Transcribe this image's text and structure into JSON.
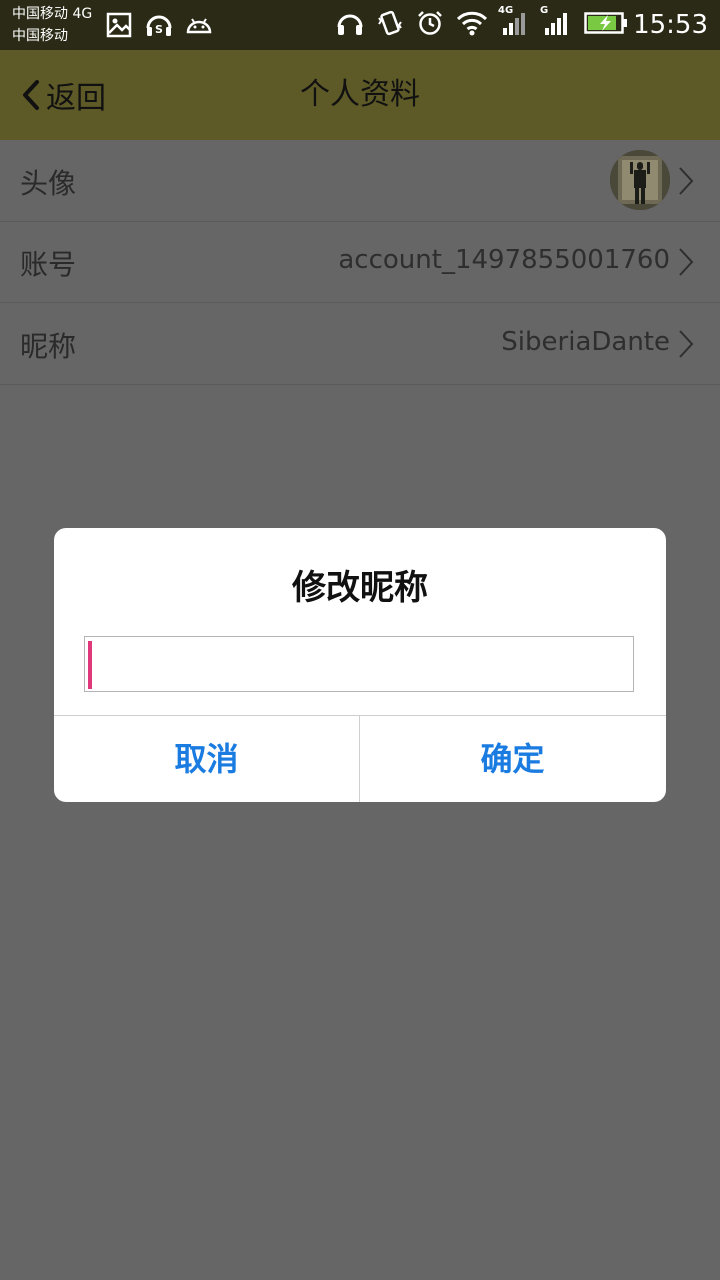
{
  "status_bar": {
    "carrier_line1": "中国移动 4G",
    "carrier_line2": "中国移动",
    "left_icons": [
      "image-icon",
      "headset-s-icon",
      "android-icon"
    ],
    "right_icons": [
      "headphones-icon",
      "vibrate-icon",
      "alarm-icon",
      "wifi-icon",
      "signal-4g-icon",
      "signal-g-icon",
      "battery-charging-icon"
    ],
    "signal1_tag": "4G",
    "signal2_tag": "G",
    "time": "15:53"
  },
  "header": {
    "back_label": "返回",
    "title": "个人资料",
    "background_color": "#5e5a27"
  },
  "profile": {
    "rows": [
      {
        "label": "头像",
        "value": ""
      },
      {
        "label": "账号",
        "value": "account_1497855001760"
      },
      {
        "label": "昵称",
        "value": "SiberiaDante"
      }
    ]
  },
  "dialog": {
    "title": "修改昵称",
    "input_value": "",
    "cancel_label": "取消",
    "confirm_label": "确定",
    "button_color": "#1a7be0",
    "caret_color": "#e0387a"
  }
}
